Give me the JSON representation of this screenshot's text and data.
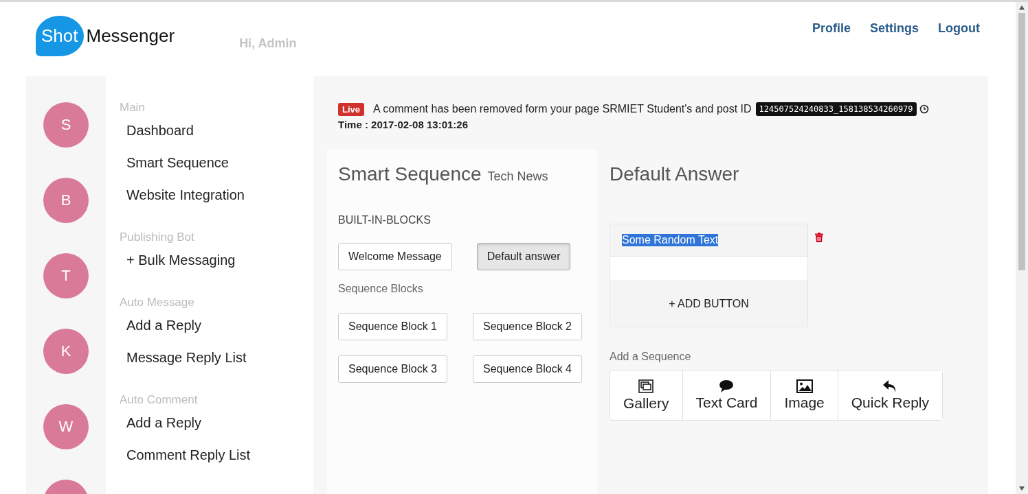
{
  "header": {
    "logo_badge": "Shot",
    "logo_text": "Messenger",
    "greeting": "Hi, Admin",
    "links": [
      "Profile",
      "Settings",
      "Logout"
    ]
  },
  "avatars": [
    {
      "letter": "S"
    },
    {
      "letter": "B"
    },
    {
      "letter": "T"
    },
    {
      "letter": "K"
    },
    {
      "letter": "W"
    }
  ],
  "sidebar": [
    {
      "heading": "Main",
      "items": [
        "Dashboard",
        "Smart Sequence",
        "Website Integration"
      ]
    },
    {
      "heading": "Publishing Bot",
      "items": [
        "+ Bulk Messaging"
      ]
    },
    {
      "heading": "Auto Message",
      "items": [
        "Add a Reply",
        "Message Reply List"
      ]
    },
    {
      "heading": "Auto Comment",
      "items": [
        "Add a Reply",
        "Comment Reply List"
      ]
    }
  ],
  "notice": {
    "badge": "Live",
    "message": "A comment has been removed form your page SRMIET Student's and post ID",
    "post_id": "124507524240833_158138534260979",
    "time": "Time : 2017-02-08 13:01:26"
  },
  "sequence": {
    "title": "Smart Sequence",
    "subtitle": "Tech News",
    "built_in_label": "BUILT-IN-BLOCKS",
    "built_in": [
      {
        "label": "Welcome Message",
        "selected": false
      },
      {
        "label": "Default answer",
        "selected": true
      }
    ],
    "blocks_label": "Sequence Blocks",
    "blocks": [
      "Sequence Block 1",
      "Sequence Block 2",
      "Sequence Block 3",
      "Sequence Block 4"
    ]
  },
  "answer": {
    "title": "Default Answer",
    "text": "Some Random Text",
    "text_selected": true,
    "add_button": "+ ADD BUTTON",
    "add_sequence_label": "Add a Sequence",
    "types": [
      {
        "kind": "gallery",
        "label": "Gallery"
      },
      {
        "kind": "text",
        "label": "Text Card"
      },
      {
        "kind": "image",
        "label": "Image"
      },
      {
        "kind": "reply",
        "label": "Quick Reply"
      }
    ]
  }
}
